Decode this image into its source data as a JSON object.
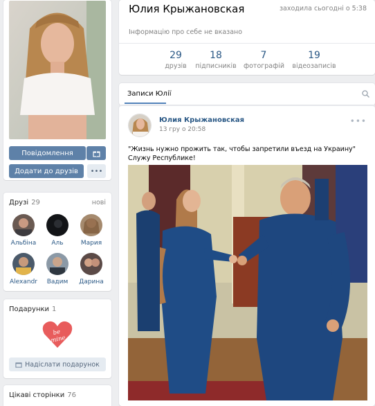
{
  "profile": {
    "name": "Юлия Крыжановская",
    "online_status": "заходила сьогодні о 5:38",
    "info_placeholder": "Інформацію про себе не вказано"
  },
  "actions": {
    "message": "Повідомлення",
    "add_friend": "Додати до друзів",
    "more": "•••"
  },
  "stats": [
    {
      "count": "29",
      "label": "друзів"
    },
    {
      "count": "18",
      "label": "підписників"
    },
    {
      "count": "7",
      "label": "фотографій"
    },
    {
      "count": "19",
      "label": "відеозаписів"
    }
  ],
  "friends": {
    "title": "Друзі",
    "count": "29",
    "new_link": "нові",
    "items": [
      {
        "name": "Альбіна"
      },
      {
        "name": "Аль"
      },
      {
        "name": "Мария"
      },
      {
        "name": "Alexandr"
      },
      {
        "name": "Вадим"
      },
      {
        "name": "Дарина"
      }
    ]
  },
  "gifts": {
    "title": "Подарунки",
    "count": "1",
    "gift_text": "be mine",
    "send_button": "Надіслати подарунок"
  },
  "pages": {
    "title": "Цікаві сторінки",
    "count": "76"
  },
  "wall": {
    "tab_label": "Записи Юлії",
    "post": {
      "author": "Юлия Крыжановская",
      "date": "13 гру о 20:58",
      "line1": "\"Жизнь нужно прожить так, чтобы запретили въезд на Украину\"",
      "line2": "Служу Республике!"
    }
  },
  "colors": {
    "link": "#2a5885",
    "button": "#5e81a8",
    "background": "#edeef0"
  }
}
